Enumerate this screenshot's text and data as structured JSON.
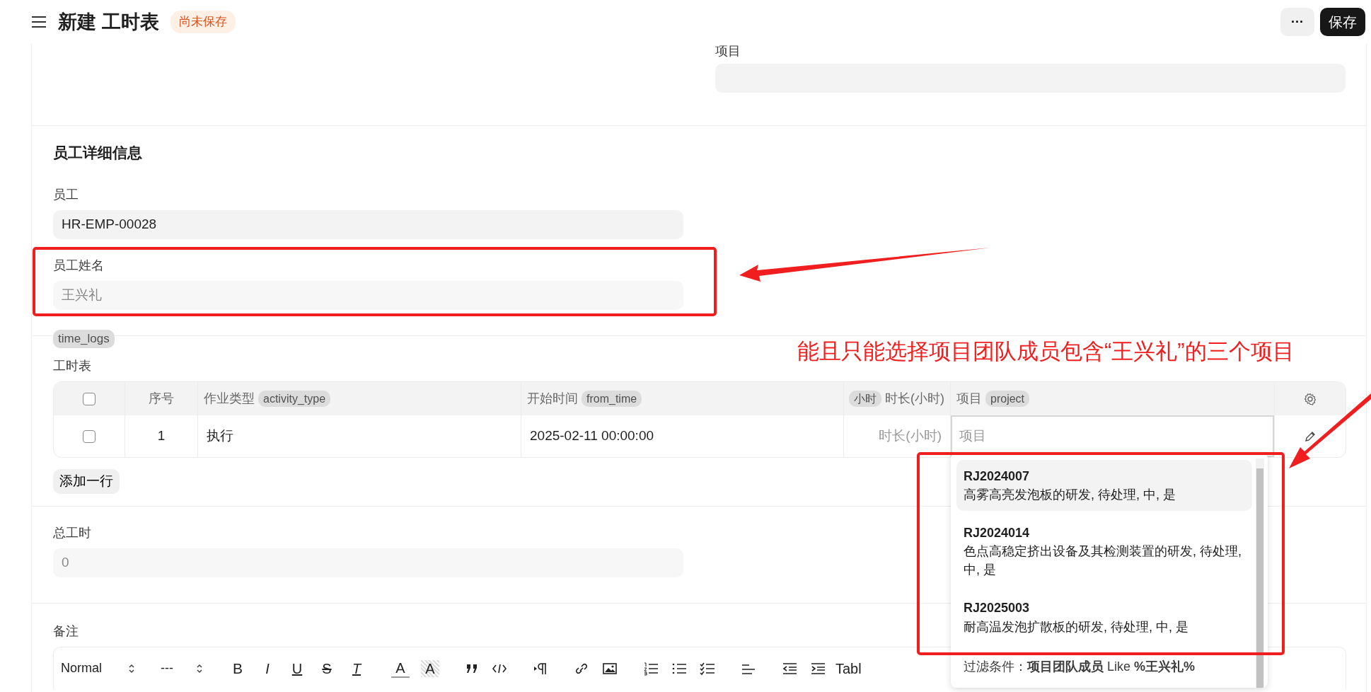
{
  "header": {
    "title": "新建 工时表",
    "status_badge": "尚未保存",
    "more_button": "···",
    "save_button": "保存"
  },
  "top_field": {
    "label": "项目"
  },
  "employee_section": {
    "title": "员工详细信息",
    "fields": [
      {
        "label": "员工",
        "value": "HR-EMP-00028",
        "readonly": false
      },
      {
        "label": "员工姓名",
        "value": "王兴礼",
        "readonly": true
      }
    ]
  },
  "time_logs": {
    "tag": "time_logs",
    "label": "工时表",
    "columns": [
      {
        "kind": "check",
        "checked": false
      },
      {
        "kind": "index",
        "label": "序号"
      },
      {
        "kind": "text",
        "label": "作业类型",
        "tag": "activity_type"
      },
      {
        "kind": "text",
        "label": "开始时间",
        "tag": "from_time"
      },
      {
        "kind": "num",
        "label": "时长(小时)",
        "tag": "小时"
      },
      {
        "kind": "text",
        "label": "项目",
        "tag": "project"
      },
      {
        "kind": "settings"
      }
    ],
    "rows": [
      {
        "checked": false,
        "index": "1",
        "activity_type": "执行",
        "from_time": "2025-02-11 00:00:00",
        "hours_placeholder": "时长(小时)",
        "project_placeholder": "项目"
      }
    ],
    "add_row_button": "添加一行"
  },
  "project_dropdown": {
    "items": [
      {
        "code": "RJ2024007",
        "description": "高雾高亮发泡板的研发, 待处理, 中, 是",
        "selected": true
      },
      {
        "code": "RJ2024014",
        "description": "色点高稳定挤出设备及其检测装置的研发, 待处理, 中, 是",
        "selected": false
      },
      {
        "code": "RJ2025003",
        "description": "耐高温发泡扩散板的研发, 待处理, 中, 是",
        "selected": false
      }
    ],
    "filter": "过滤条件：**项目团队成员** Like **%王兴礼%**"
  },
  "total_section": {
    "label": "总工时",
    "value": "0"
  },
  "notes_section": {
    "label": "备注",
    "format_select": "Normal",
    "size_select": "---",
    "letter_buttons": [
      {
        "kind": "bold",
        "glyph": "B"
      },
      {
        "kind": "italic",
        "glyph": "I"
      },
      {
        "kind": "underline",
        "glyph": "U"
      },
      {
        "kind": "strike",
        "glyph": "S"
      },
      {
        "kind": "clean",
        "glyph": "T"
      },
      {
        "kind": "color",
        "glyph": "A"
      },
      {
        "kind": "background",
        "glyph": "A"
      }
    ],
    "table_button": "Tabl"
  },
  "annotation": {
    "note": "能且只能选择项目团队成员包含“王兴礼”的三个项目"
  }
}
